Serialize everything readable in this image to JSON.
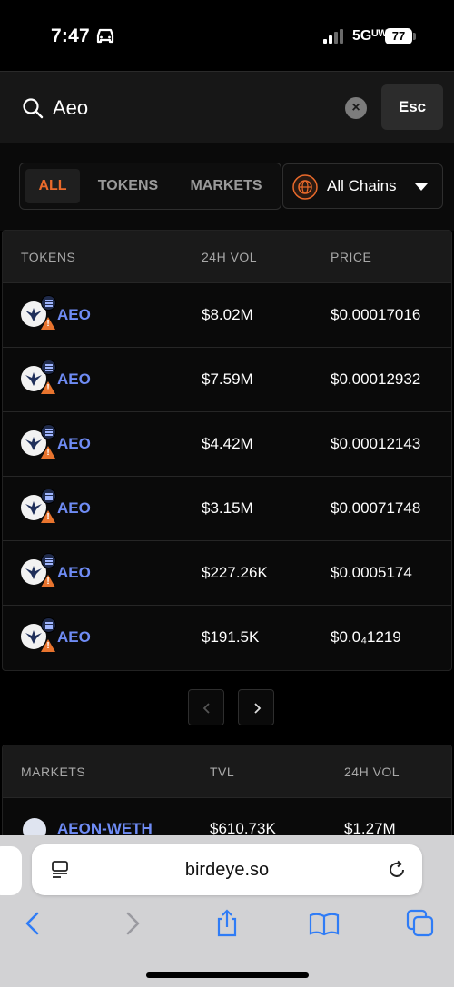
{
  "status_bar": {
    "time": "7:47",
    "network": "5Gᵁᵂ",
    "battery": "77"
  },
  "search": {
    "query": "Aeo",
    "esc_label": "Esc"
  },
  "filters": {
    "tabs": [
      "ALL",
      "TOKENS",
      "MARKETS"
    ],
    "active_tab": "ALL",
    "chain_select": "All Chains"
  },
  "tokens_table": {
    "headers": [
      "TOKENS",
      "24H VOL",
      "PRICE"
    ],
    "rows": [
      {
        "symbol": "AEO",
        "vol": "$8.02M",
        "price": "$0.00017016"
      },
      {
        "symbol": "AEO",
        "vol": "$7.59M",
        "price": "$0.00012932"
      },
      {
        "symbol": "AEO",
        "vol": "$4.42M",
        "price": "$0.00012143"
      },
      {
        "symbol": "AEO",
        "vol": "$3.15M",
        "price": "$0.00071748"
      },
      {
        "symbol": "AEO",
        "vol": "$227.26K",
        "price": "$0.0005174"
      },
      {
        "symbol": "AEO",
        "vol": "$191.5K",
        "price": "$0.0₄1219"
      }
    ]
  },
  "markets_table": {
    "headers": [
      "MARKETS",
      "TVL",
      "24H VOL"
    ],
    "rows": [
      {
        "name": "AEON-WETH",
        "tvl": "$610.73K",
        "vol": "$1.27M"
      }
    ]
  },
  "browser": {
    "url": "birdeye.so"
  },
  "colors": {
    "accent": "#ea6a2b",
    "link": "#6f8cf5",
    "warning": "#e8742e"
  },
  "icons": [
    "car-icon",
    "signal-icon",
    "search-icon",
    "clear-icon",
    "globe-icon",
    "caret-down-icon",
    "warning-icon",
    "solana-icon",
    "chevron-left-icon",
    "chevron-right-icon",
    "reader-icon",
    "reload-icon",
    "back-icon",
    "forward-icon",
    "share-icon",
    "bookmarks-icon",
    "tabs-icon"
  ]
}
